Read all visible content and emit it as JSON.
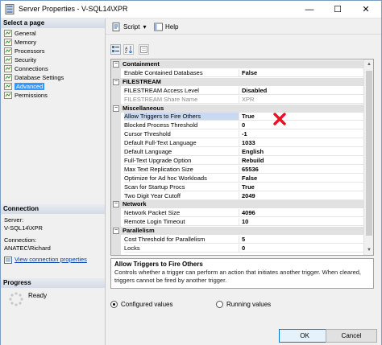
{
  "window": {
    "title": "Server Properties - V-SQL14\\XPR",
    "minimize": "—",
    "maximize": "☐",
    "close": "✕"
  },
  "left": {
    "select_page_header": "Select a page",
    "pages": [
      {
        "label": "General",
        "icon": "page-icon"
      },
      {
        "label": "Memory",
        "icon": "page-icon"
      },
      {
        "label": "Processors",
        "icon": "page-icon"
      },
      {
        "label": "Security",
        "icon": "page-icon"
      },
      {
        "label": "Connections",
        "icon": "page-icon"
      },
      {
        "label": "Database Settings",
        "icon": "page-icon"
      },
      {
        "label": "Advanced",
        "icon": "page-icon",
        "selected": true
      },
      {
        "label": "Permissions",
        "icon": "page-icon"
      }
    ],
    "connection_header": "Connection",
    "server_label": "Server:",
    "server_value": "V-SQL14\\XPR",
    "connection_label": "Connection:",
    "connection_value": "ANATEC\\Richard",
    "view_link": "View connection properties",
    "progress_header": "Progress",
    "progress_status": "Ready"
  },
  "toolbar": {
    "script": "Script",
    "script_dropdown": "▾",
    "help": "Help"
  },
  "grid": {
    "rows": [
      {
        "kind": "cat",
        "name": "Containment"
      },
      {
        "kind": "prop",
        "name": "Enable Contained Databases",
        "value": "False"
      },
      {
        "kind": "cat",
        "name": "FILESTREAM"
      },
      {
        "kind": "prop",
        "name": "FILESTREAM Access Level",
        "value": "Disabled"
      },
      {
        "kind": "prop",
        "name": "FILESTREAM Share Name",
        "value": "XPR",
        "disabled": true
      },
      {
        "kind": "cat",
        "name": "Miscellaneous"
      },
      {
        "kind": "prop",
        "name": "Allow Triggers to Fire Others",
        "value": "True",
        "selected": true
      },
      {
        "kind": "prop",
        "name": "Blocked Process Threshold",
        "value": "0"
      },
      {
        "kind": "prop",
        "name": "Cursor Threshold",
        "value": "-1"
      },
      {
        "kind": "prop",
        "name": "Default Full-Text Language",
        "value": "1033"
      },
      {
        "kind": "prop",
        "name": "Default Language",
        "value": "English"
      },
      {
        "kind": "prop",
        "name": "Full-Text Upgrade Option",
        "value": "Rebuild"
      },
      {
        "kind": "prop",
        "name": "Max Text Replication Size",
        "value": "65536"
      },
      {
        "kind": "prop",
        "name": "Optimize for Ad hoc Workloads",
        "value": "False"
      },
      {
        "kind": "prop",
        "name": "Scan for Startup Procs",
        "value": "True"
      },
      {
        "kind": "prop",
        "name": "Two Digit Year Cutoff",
        "value": "2049"
      },
      {
        "kind": "cat",
        "name": "Network"
      },
      {
        "kind": "prop",
        "name": "Network Packet Size",
        "value": "4096"
      },
      {
        "kind": "prop",
        "name": "Remote Login Timeout",
        "value": "10"
      },
      {
        "kind": "cat",
        "name": "Parallelism"
      },
      {
        "kind": "prop",
        "name": "Cost Threshold for Parallelism",
        "value": "5"
      },
      {
        "kind": "prop",
        "name": "Locks",
        "value": "0"
      }
    ]
  },
  "description": {
    "title": "Allow Triggers to Fire Others",
    "text": "Controls whether a trigger can perform an action that initiates another trigger. When cleared, triggers cannot be fired by another trigger."
  },
  "options": {
    "configured": "Configured values",
    "running": "Running values",
    "selected": "configured"
  },
  "buttons": {
    "ok": "OK",
    "cancel": "Cancel"
  },
  "colors": {
    "accent": "#3399ff",
    "marker": "#e81123"
  }
}
